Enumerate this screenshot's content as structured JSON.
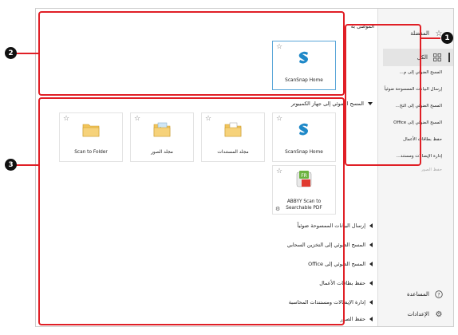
{
  "sidebar": {
    "favorites": "المفضلة",
    "all": "الكل",
    "sub_items": [
      "المسح الضوئي إلى م...",
      "إرسال البيانات الممسوحة ضوئياً",
      "المسح الضوئي إلى التخ...",
      "المسح الضوئي إلى Office",
      "حفظ بطاقات الأعمال",
      "إدارة الإيصالات ومستند...",
      "حفظ الصور"
    ],
    "help": "المساعدة",
    "settings": "الإعدادات"
  },
  "recommended": {
    "title": "الموصى به",
    "card_label": "ScanSnap Home"
  },
  "scan_to_computer": {
    "title": "المسح الضوئي إلى جهاز الكمبيوتر",
    "cards": [
      "ScanSnap Home",
      "مجلد المستندات",
      "مجلد الصور",
      "Scan to Folder"
    ],
    "abbyy_label_line1": "ABBYY Scan to",
    "abbyy_label_line2": "Searchable PDF"
  },
  "categories": [
    "إرسال البيانات الممسوحة ضوئياً",
    "المسح الضوئي إلى التخزين السحابي",
    "المسح الضوئي إلى Office",
    "حفظ بطاقات الأعمال",
    "إدارة الإيصالات ومستندات المحاسبة",
    "حفظ الصور"
  ],
  "callouts": [
    "1",
    "2",
    "3"
  ],
  "colors": {
    "annotation": "#e01f26",
    "selection": "#5aa6d8",
    "scansnap": "#1e88c8"
  }
}
